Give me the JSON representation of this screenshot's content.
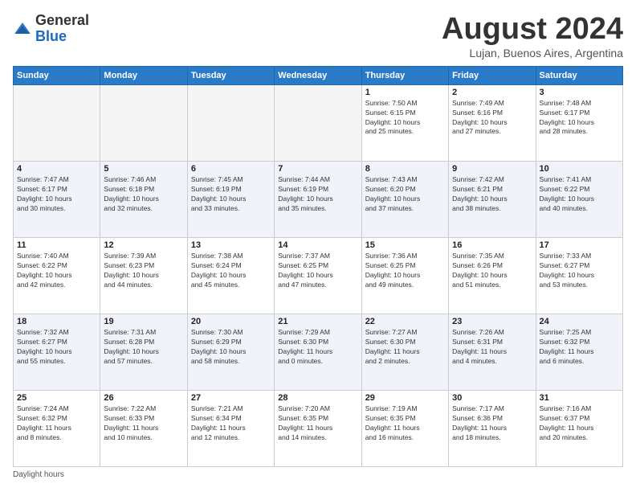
{
  "logo": {
    "general": "General",
    "blue": "Blue"
  },
  "title": "August 2024",
  "subtitle": "Lujan, Buenos Aires, Argentina",
  "days_header": [
    "Sunday",
    "Monday",
    "Tuesday",
    "Wednesday",
    "Thursday",
    "Friday",
    "Saturday"
  ],
  "footer": "Daylight hours",
  "weeks": [
    [
      {
        "day": "",
        "info": ""
      },
      {
        "day": "",
        "info": ""
      },
      {
        "day": "",
        "info": ""
      },
      {
        "day": "",
        "info": ""
      },
      {
        "day": "1",
        "info": "Sunrise: 7:50 AM\nSunset: 6:15 PM\nDaylight: 10 hours\nand 25 minutes."
      },
      {
        "day": "2",
        "info": "Sunrise: 7:49 AM\nSunset: 6:16 PM\nDaylight: 10 hours\nand 27 minutes."
      },
      {
        "day": "3",
        "info": "Sunrise: 7:48 AM\nSunset: 6:17 PM\nDaylight: 10 hours\nand 28 minutes."
      }
    ],
    [
      {
        "day": "4",
        "info": "Sunrise: 7:47 AM\nSunset: 6:17 PM\nDaylight: 10 hours\nand 30 minutes."
      },
      {
        "day": "5",
        "info": "Sunrise: 7:46 AM\nSunset: 6:18 PM\nDaylight: 10 hours\nand 32 minutes."
      },
      {
        "day": "6",
        "info": "Sunrise: 7:45 AM\nSunset: 6:19 PM\nDaylight: 10 hours\nand 33 minutes."
      },
      {
        "day": "7",
        "info": "Sunrise: 7:44 AM\nSunset: 6:19 PM\nDaylight: 10 hours\nand 35 minutes."
      },
      {
        "day": "8",
        "info": "Sunrise: 7:43 AM\nSunset: 6:20 PM\nDaylight: 10 hours\nand 37 minutes."
      },
      {
        "day": "9",
        "info": "Sunrise: 7:42 AM\nSunset: 6:21 PM\nDaylight: 10 hours\nand 38 minutes."
      },
      {
        "day": "10",
        "info": "Sunrise: 7:41 AM\nSunset: 6:22 PM\nDaylight: 10 hours\nand 40 minutes."
      }
    ],
    [
      {
        "day": "11",
        "info": "Sunrise: 7:40 AM\nSunset: 6:22 PM\nDaylight: 10 hours\nand 42 minutes."
      },
      {
        "day": "12",
        "info": "Sunrise: 7:39 AM\nSunset: 6:23 PM\nDaylight: 10 hours\nand 44 minutes."
      },
      {
        "day": "13",
        "info": "Sunrise: 7:38 AM\nSunset: 6:24 PM\nDaylight: 10 hours\nand 45 minutes."
      },
      {
        "day": "14",
        "info": "Sunrise: 7:37 AM\nSunset: 6:25 PM\nDaylight: 10 hours\nand 47 minutes."
      },
      {
        "day": "15",
        "info": "Sunrise: 7:36 AM\nSunset: 6:25 PM\nDaylight: 10 hours\nand 49 minutes."
      },
      {
        "day": "16",
        "info": "Sunrise: 7:35 AM\nSunset: 6:26 PM\nDaylight: 10 hours\nand 51 minutes."
      },
      {
        "day": "17",
        "info": "Sunrise: 7:33 AM\nSunset: 6:27 PM\nDaylight: 10 hours\nand 53 minutes."
      }
    ],
    [
      {
        "day": "18",
        "info": "Sunrise: 7:32 AM\nSunset: 6:27 PM\nDaylight: 10 hours\nand 55 minutes."
      },
      {
        "day": "19",
        "info": "Sunrise: 7:31 AM\nSunset: 6:28 PM\nDaylight: 10 hours\nand 57 minutes."
      },
      {
        "day": "20",
        "info": "Sunrise: 7:30 AM\nSunset: 6:29 PM\nDaylight: 10 hours\nand 58 minutes."
      },
      {
        "day": "21",
        "info": "Sunrise: 7:29 AM\nSunset: 6:30 PM\nDaylight: 11 hours\nand 0 minutes."
      },
      {
        "day": "22",
        "info": "Sunrise: 7:27 AM\nSunset: 6:30 PM\nDaylight: 11 hours\nand 2 minutes."
      },
      {
        "day": "23",
        "info": "Sunrise: 7:26 AM\nSunset: 6:31 PM\nDaylight: 11 hours\nand 4 minutes."
      },
      {
        "day": "24",
        "info": "Sunrise: 7:25 AM\nSunset: 6:32 PM\nDaylight: 11 hours\nand 6 minutes."
      }
    ],
    [
      {
        "day": "25",
        "info": "Sunrise: 7:24 AM\nSunset: 6:32 PM\nDaylight: 11 hours\nand 8 minutes."
      },
      {
        "day": "26",
        "info": "Sunrise: 7:22 AM\nSunset: 6:33 PM\nDaylight: 11 hours\nand 10 minutes."
      },
      {
        "day": "27",
        "info": "Sunrise: 7:21 AM\nSunset: 6:34 PM\nDaylight: 11 hours\nand 12 minutes."
      },
      {
        "day": "28",
        "info": "Sunrise: 7:20 AM\nSunset: 6:35 PM\nDaylight: 11 hours\nand 14 minutes."
      },
      {
        "day": "29",
        "info": "Sunrise: 7:19 AM\nSunset: 6:35 PM\nDaylight: 11 hours\nand 16 minutes."
      },
      {
        "day": "30",
        "info": "Sunrise: 7:17 AM\nSunset: 6:36 PM\nDaylight: 11 hours\nand 18 minutes."
      },
      {
        "day": "31",
        "info": "Sunrise: 7:16 AM\nSunset: 6:37 PM\nDaylight: 11 hours\nand 20 minutes."
      }
    ]
  ]
}
